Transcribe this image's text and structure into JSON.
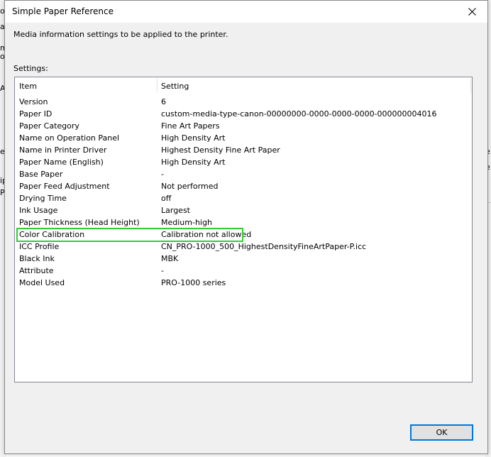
{
  "background_window": {
    "left_fragments": [
      "o",
      "a",
      "m",
      "ol",
      "A",
      "e",
      "ip",
      "Pa"
    ],
    "right_fragments": [
      "e",
      "e"
    ]
  },
  "dialog": {
    "title": "Simple Paper Reference",
    "close_icon": "close-icon",
    "description": "Media information settings to be applied to the printer.",
    "settings_label": "Settings:",
    "columns": [
      "Item",
      "Setting"
    ],
    "rows": [
      {
        "item": "Version",
        "setting": "6"
      },
      {
        "item": "Paper ID",
        "setting": "custom-media-type-canon-00000000-0000-0000-0000-000000004016"
      },
      {
        "item": "Paper Category",
        "setting": "Fine Art Papers"
      },
      {
        "item": "Name on Operation Panel",
        "setting": "High Density Art"
      },
      {
        "item": "Name in Printer Driver",
        "setting": "Highest Density Fine Art Paper"
      },
      {
        "item": "Paper Name (English)",
        "setting": "High Density Art"
      },
      {
        "item": "Base Paper",
        "setting": "-"
      },
      {
        "item": "Paper Feed Adjustment",
        "setting": "Not performed"
      },
      {
        "item": "Drying Time",
        "setting": "off"
      },
      {
        "item": "Ink Usage",
        "setting": "Largest"
      },
      {
        "item": "Paper Thickness (Head Height)",
        "setting": "Medium-high"
      },
      {
        "item": "Color Calibration",
        "setting": "Calibration not allowed"
      },
      {
        "item": "ICC Profile",
        "setting": "CN_PRO-1000_500_HighestDensityFineArtPaper-P.icc"
      },
      {
        "item": "Black Ink",
        "setting": "MBK"
      },
      {
        "item": "Attribute",
        "setting": "-"
      },
      {
        "item": "Model Used",
        "setting": "PRO-1000 series"
      }
    ],
    "highlight_color": "#33cc33",
    "ok_label": "OK",
    "accent_color": "#0078d7"
  }
}
